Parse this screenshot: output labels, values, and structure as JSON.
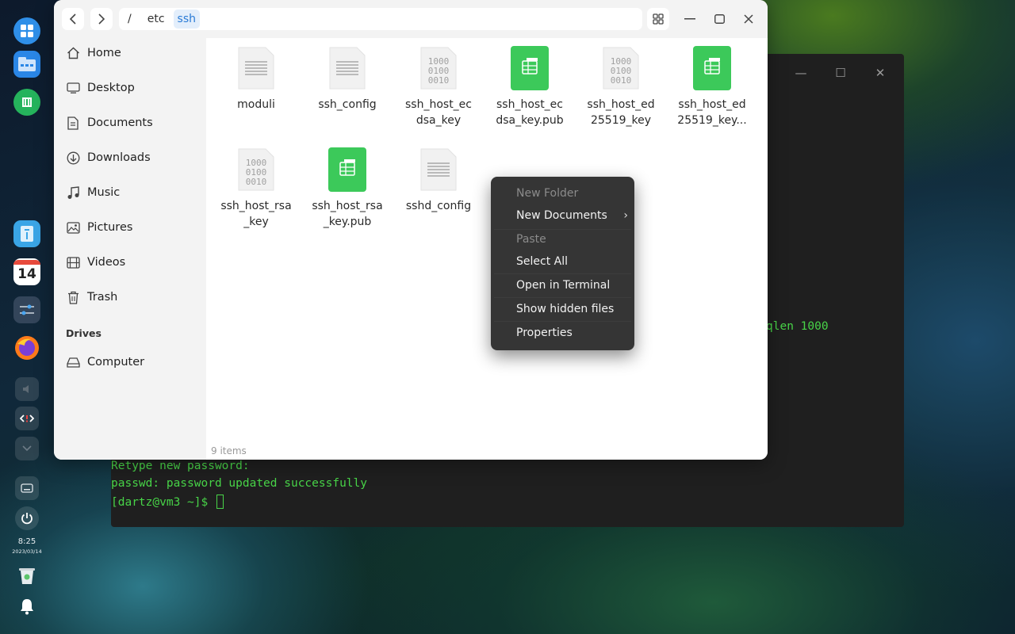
{
  "dock": {
    "clock_time": "8:25",
    "clock_date": "2023/03/14",
    "calendar_day": "14"
  },
  "terminal": {
    "partial_line": "qlen 1000",
    "line1": "Retype new password:",
    "line2": "passwd: password updated successfully",
    "prompt": "[dartz@vm3 ~]$ "
  },
  "file_manager": {
    "breadcrumb": {
      "root": "/",
      "parts": [
        "etc",
        "ssh"
      ]
    },
    "sidebar": {
      "items": [
        {
          "label": "Home",
          "icon": "home-icon"
        },
        {
          "label": "Desktop",
          "icon": "desktop-icon"
        },
        {
          "label": "Documents",
          "icon": "documents-icon"
        },
        {
          "label": "Downloads",
          "icon": "downloads-icon"
        },
        {
          "label": "Music",
          "icon": "music-icon"
        },
        {
          "label": "Pictures",
          "icon": "pictures-icon"
        },
        {
          "label": "Videos",
          "icon": "videos-icon"
        },
        {
          "label": "Trash",
          "icon": "trash-icon"
        }
      ],
      "drives_heading": "Drives",
      "drives": [
        {
          "label": "Computer",
          "icon": "drive-icon"
        }
      ]
    },
    "files": [
      {
        "line1": "moduli",
        "line2": "",
        "type": "text"
      },
      {
        "line1": "ssh_config",
        "line2": "",
        "type": "text"
      },
      {
        "line1": "ssh_host_ec",
        "line2": "dsa_key",
        "type": "binary"
      },
      {
        "line1": "ssh_host_ec",
        "line2": "dsa_key.pub",
        "type": "pub"
      },
      {
        "line1": "ssh_host_ed",
        "line2": "25519_key",
        "type": "binary"
      },
      {
        "line1": "ssh_host_ed",
        "line2": "25519_key...",
        "type": "pub"
      },
      {
        "line1": "ssh_host_rsa",
        "line2": "_key",
        "type": "binary"
      },
      {
        "line1": "ssh_host_rsa",
        "line2": "_key.pub",
        "type": "pub"
      },
      {
        "line1": "sshd_config",
        "line2": "",
        "type": "text"
      }
    ],
    "binary_glyph": [
      "1000",
      "0100",
      "0010"
    ],
    "status": "9 items"
  },
  "context_menu": {
    "new_folder": "New Folder",
    "new_documents": "New Documents",
    "paste": "Paste",
    "select_all": "Select All",
    "open_terminal": "Open in Terminal",
    "show_hidden": "Show hidden files",
    "properties": "Properties"
  },
  "colors": {
    "terminal_green": "#48d448",
    "pub_file_green": "#3cc95a",
    "accent_blue": "#2a7bd6"
  }
}
